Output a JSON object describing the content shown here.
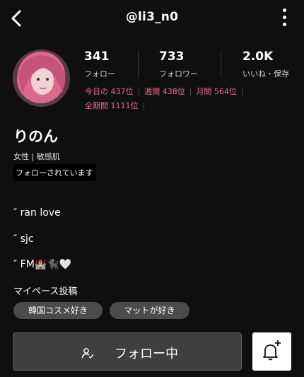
{
  "header": {
    "username": "@li3_n0",
    "back_icon": "chevron-left-icon",
    "more_icon": "more-vertical-icon"
  },
  "stats": [
    {
      "value": "341",
      "label": "フォロー"
    },
    {
      "value": "733",
      "label": "フォロワー"
    },
    {
      "value": "2.0K",
      "label": "いいね・保存"
    }
  ],
  "ranks": {
    "today": "今日の 437位",
    "week": "週間 438位",
    "month": "月間 564位",
    "all_time": "全期間 1111位",
    "color": "#f06b8a"
  },
  "profile": {
    "name": "りのん",
    "sub": "女性 | 敏感肌",
    "follows_you": "フォローされています"
  },
  "bio": [
    "″ ran love",
    "″ sjc",
    "″ FM🏰🐈‍⬛🤍"
  ],
  "hashtags": {
    "title": "マイペース投稿",
    "tags": [
      "韓国コスメ好き",
      "マットが好き"
    ]
  },
  "actions": {
    "follow_label": "フォロー中",
    "follow_icon": "user-check-icon",
    "bell_icon": "bell-plus-icon"
  }
}
